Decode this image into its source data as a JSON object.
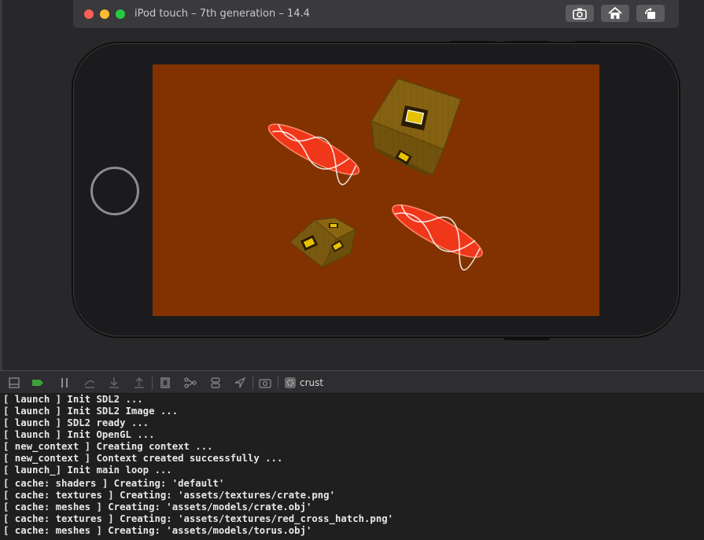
{
  "window": {
    "title": "iPod touch – 7th generation – 14.4",
    "toolbar_buttons": [
      {
        "name": "screenshot",
        "icon": "camera-icon"
      },
      {
        "name": "home",
        "icon": "home-icon"
      },
      {
        "name": "rotate",
        "icon": "rotate-icon"
      }
    ]
  },
  "screen": {
    "background_color": "#823200",
    "objects": [
      "crate",
      "crate",
      "red-torus",
      "red-torus"
    ]
  },
  "console": {
    "toolbar": {
      "icons": [
        "hide-panel-icon",
        "breakpoint-icon",
        "pause-icon",
        "step-over-icon",
        "step-into-icon",
        "step-out-icon",
        "view-hierarchy-icon",
        "memory-graph-icon",
        "environment-overrides-icon",
        "location-icon",
        "camera-icon",
        "process-icon"
      ],
      "process_name": "crust"
    },
    "lines": [
      "[ launch ] Init SDL2 ...",
      "[ launch ] Init SDL2 Image ...",
      "[ launch ] SDL2 ready ...",
      "[ launch ] Init OpenGL ...",
      "[ new_context ] Creating context ...",
      "[ new_context ] Context created successfully ...",
      "[ launch_] Init main loop ...",
      "[ cache: shaders ] Creating: 'default'",
      "[ cache: textures ] Creating: 'assets/textures/crate.png'",
      "[ cache: meshes ] Creating: 'assets/models/crate.obj'",
      "[ cache: textures ] Creating: 'assets/textures/red_cross_hatch.png'",
      "[ cache: meshes ] Creating: 'assets/models/torus.obj'"
    ]
  }
}
